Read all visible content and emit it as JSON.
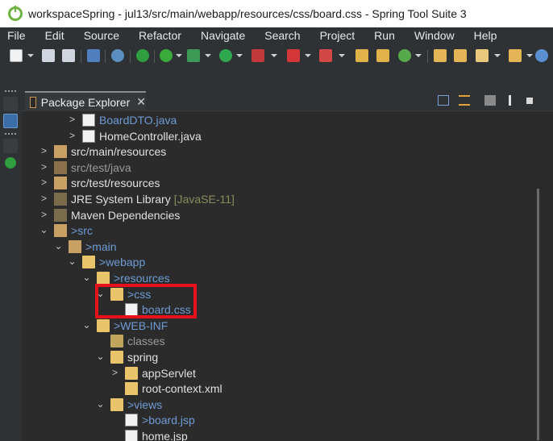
{
  "window": {
    "title": "workspaceSpring - jul13/src/main/webapp/resources/css/board.css - Spring Tool Suite 3"
  },
  "menu": [
    "File",
    "Edit",
    "Source",
    "Refactor",
    "Navigate",
    "Search",
    "Project",
    "Run",
    "Window",
    "Help"
  ],
  "panel": {
    "tab_label": "Package Explorer",
    "close_glyph": "✕"
  },
  "tree": [
    {
      "label": "BoardDTO.java",
      "prefix": "",
      "color": "#6e9bd6",
      "icon": "java-file-icon",
      "chevron": ">"
    },
    {
      "label": "HomeController.java",
      "prefix": "",
      "color": "#e0e0e0",
      "icon": "java-file-icon",
      "chevron": ">"
    },
    {
      "label": "src/main/resources",
      "prefix": "",
      "color": "#e0e0e0",
      "icon": "source-folder-icon",
      "chevron": ">"
    },
    {
      "label": "src/test/java",
      "prefix": "",
      "color": "#9a9a9a",
      "icon": "source-folder-icon",
      "chevron": ">"
    },
    {
      "label": "src/test/resources",
      "prefix": "",
      "color": "#e0e0e0",
      "icon": "source-folder-icon",
      "chevron": ">"
    },
    {
      "label": "JRE System Library",
      "suffix": "[JavaSE-11]",
      "prefix": "",
      "color": "#e0e0e0",
      "icon": "library-icon",
      "chevron": ">"
    },
    {
      "label": "Maven Dependencies",
      "prefix": "",
      "color": "#e0e0e0",
      "icon": "library-icon",
      "chevron": ">"
    },
    {
      "label": "src",
      "prefix": "> ",
      "color": "#6e9bd6",
      "icon": "folder-s-icon",
      "chevron": "⌄"
    },
    {
      "label": "main",
      "prefix": "> ",
      "color": "#6e9bd6",
      "icon": "folder-s-icon",
      "chevron": "⌄"
    },
    {
      "label": "webapp",
      "prefix": "> ",
      "color": "#6e9bd6",
      "icon": "folder-s-icon",
      "chevron": "⌄"
    },
    {
      "label": "resources",
      "prefix": "> ",
      "color": "#6e9bd6",
      "icon": "folder-q-icon",
      "chevron": "⌄"
    },
    {
      "label": "css",
      "prefix": "> ",
      "color": "#6e9bd6",
      "icon": "folder-q-icon",
      "chevron": "⌄"
    },
    {
      "label": "board.css",
      "prefix": "",
      "color": "#6e9bd6",
      "icon": "file-q-icon",
      "chevron": ""
    },
    {
      "label": "WEB-INF",
      "prefix": "> ",
      "color": "#6e9bd6",
      "icon": "folder-s-icon",
      "chevron": "⌄"
    },
    {
      "label": "classes",
      "prefix": "",
      "color": "#9a9a9a",
      "icon": "folder-icon",
      "chevron": ""
    },
    {
      "label": "spring",
      "prefix": "",
      "color": "#e0e0e0",
      "icon": "folder-s-icon",
      "chevron": "⌄"
    },
    {
      "label": "appServlet",
      "prefix": "",
      "color": "#e0e0e0",
      "icon": "folder-s-icon",
      "chevron": ">"
    },
    {
      "label": "root-context.xml",
      "prefix": "",
      "color": "#e0e0e0",
      "icon": "xml-file-icon",
      "chevron": ""
    },
    {
      "label": "views",
      "prefix": "> ",
      "color": "#6e9bd6",
      "icon": "folder-icon",
      "chevron": "⌄"
    },
    {
      "label": "board.jsp",
      "prefix": "> ",
      "color": "#6e9bd6",
      "icon": "jsp-file-icon",
      "chevron": ""
    },
    {
      "label": "home.jsp",
      "prefix": "",
      "color": "#e0e0e0",
      "icon": "jsp-file-icon",
      "chevron": ""
    }
  ],
  "colors": {
    "highlight": "#e8101a",
    "accent_green": "#6db33f",
    "modified_blue": "#6e9bd6",
    "disabled_gray": "#9a9a9a",
    "jre_version": "#8a8a5c"
  }
}
